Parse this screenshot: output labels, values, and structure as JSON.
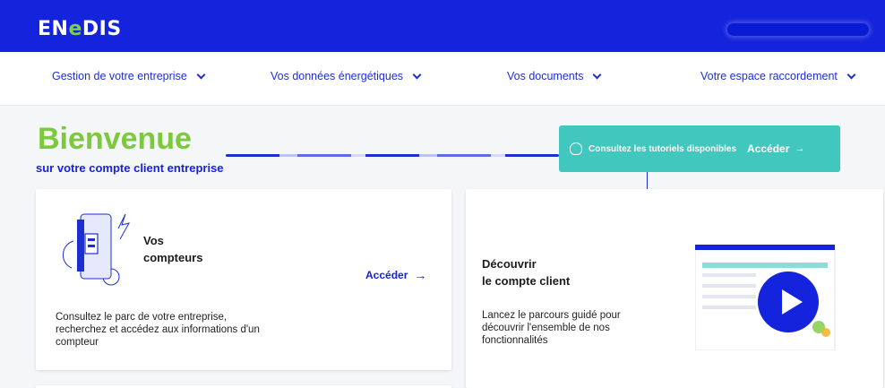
{
  "header": {
    "logo_prefix": "EN",
    "logo_accent": "e",
    "logo_suffix": "DIS"
  },
  "nav": {
    "items": [
      {
        "label": "Gestion de votre entreprise"
      },
      {
        "label": "Vos données énergétiques"
      },
      {
        "label": "Vos documents"
      },
      {
        "label": "Votre espace raccordement"
      }
    ]
  },
  "welcome": {
    "title": "Bienvenue",
    "subtitle": "sur votre compte client entreprise"
  },
  "tutorial": {
    "text": "Consultez les tutoriels disponibles",
    "link": "Accéder",
    "arrow": "→"
  },
  "cards": {
    "meters": {
      "title_line1": "Vos",
      "title_line2": "compteurs",
      "link": "Accéder",
      "arrow": "→",
      "desc_line1": "Consultez le parc de votre entreprise,",
      "desc_line2": "recherchez et accédez aux informations d'un",
      "desc_line3": "compteur"
    },
    "discover": {
      "title_line1": "Découvrir",
      "title_line2": "le compte client",
      "desc_line1": "Lancez le parcours guidé pour",
      "desc_line2": "découvrir l'ensemble de nos",
      "desc_line3": "fonctionnalités"
    }
  },
  "colors": {
    "brand_blue": "#1423dc",
    "brand_green": "#7cc93d",
    "teal": "#41c7bd"
  },
  "icons": {
    "nav_chevron": "chevron-down-icon",
    "tutorial_bulb": "lightbulb-icon",
    "video_play": "play-icon",
    "meter": "electric-meter-icon"
  }
}
